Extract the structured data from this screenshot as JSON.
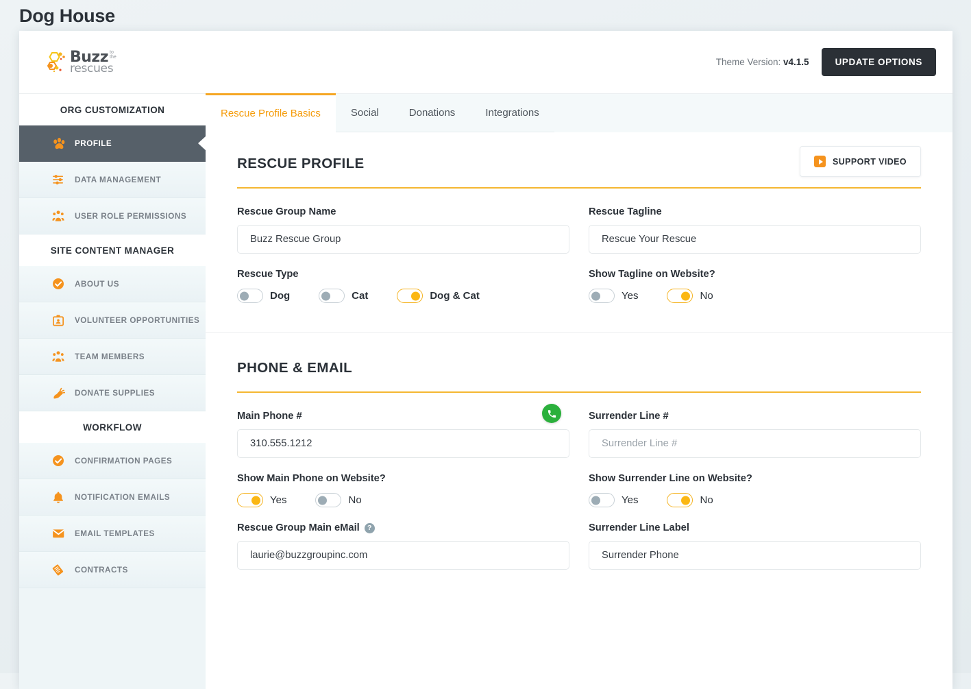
{
  "page": {
    "title": "Dog House"
  },
  "topbar": {
    "logo": {
      "name": "buzz-to-the-rescues-logo",
      "word1": "Buzz",
      "small1": "to",
      "small2": "the",
      "word2": "rescues"
    },
    "theme_version_label": "Theme Version:",
    "theme_version_value": "v4.1.5",
    "update_button": "UPDATE OPTIONS"
  },
  "sidebar": {
    "groups": [
      {
        "heading": "ORG CUSTOMIZATION",
        "items": [
          {
            "label": "PROFILE",
            "icon": "paw-icon",
            "active": true
          },
          {
            "label": "DATA MANAGEMENT",
            "icon": "sliders-icon",
            "active": false
          },
          {
            "label": "USER ROLE PERMISSIONS",
            "icon": "users-icon",
            "active": false
          }
        ]
      },
      {
        "heading": "SITE CONTENT MANAGER",
        "items": [
          {
            "label": "ABOUT US",
            "icon": "check-circle-icon",
            "active": false
          },
          {
            "label": "VOLUNTEER OPPORTUNITIES",
            "icon": "id-badge-icon",
            "active": false
          },
          {
            "label": "TEAM MEMBERS",
            "icon": "users-icon",
            "active": false
          },
          {
            "label": "DONATE SUPPLIES",
            "icon": "carrot-icon",
            "active": false
          }
        ]
      },
      {
        "heading": "WORKFLOW",
        "items": [
          {
            "label": "CONFIRMATION PAGES",
            "icon": "check-circle-icon",
            "active": false
          },
          {
            "label": "NOTIFICATION EMAILS",
            "icon": "bell-icon",
            "active": false
          },
          {
            "label": "EMAIL TEMPLATES",
            "icon": "envelope-icon",
            "active": false
          },
          {
            "label": "CONTRACTS",
            "icon": "contract-tag-icon",
            "active": false
          }
        ]
      }
    ]
  },
  "tabs": [
    {
      "label": "Rescue Profile Basics",
      "active": true
    },
    {
      "label": "Social",
      "active": false
    },
    {
      "label": "Donations",
      "active": false
    },
    {
      "label": "Integrations",
      "active": false
    }
  ],
  "rescue_profile": {
    "title": "RESCUE PROFILE",
    "support_video_button": "SUPPORT VIDEO",
    "group_name": {
      "label": "Rescue Group Name",
      "value": "Buzz Rescue Group"
    },
    "tagline": {
      "label": "Rescue Tagline",
      "value": "Rescue Your Rescue"
    },
    "rescue_type": {
      "label": "Rescue Type",
      "options": [
        {
          "label": "Dog",
          "on": false
        },
        {
          "label": "Cat",
          "on": false
        },
        {
          "label": "Dog & Cat",
          "on": true
        }
      ]
    },
    "show_tagline": {
      "label": "Show Tagline on Website?",
      "options": [
        {
          "label": "Yes",
          "on": false
        },
        {
          "label": "No",
          "on": true
        }
      ]
    }
  },
  "phone_email": {
    "title": "PHONE & EMAIL",
    "main_phone": {
      "label": "Main Phone #",
      "value": "310.555.1212",
      "verified": true,
      "verified_icon": "phone-check-icon"
    },
    "surrender_line": {
      "label": "Surrender Line #",
      "placeholder": "Surrender Line #",
      "value": ""
    },
    "show_main_phone": {
      "label": "Show Main Phone on Website?",
      "options": [
        {
          "label": "Yes",
          "on": true
        },
        {
          "label": "No",
          "on": false
        }
      ]
    },
    "show_surrender_line": {
      "label": "Show Surrender Line on Website?",
      "options": [
        {
          "label": "Yes",
          "on": false
        },
        {
          "label": "No",
          "on": true
        }
      ]
    },
    "main_email": {
      "label": "Rescue Group Main eMail",
      "value": "laurie@buzzgroupinc.com",
      "help": "?"
    },
    "surrender_label": {
      "label": "Surrender Line Label",
      "value": "Surrender Phone"
    }
  },
  "colors": {
    "accent": "#f5a623",
    "active_nav": "#566069",
    "dark": "#2b3036",
    "success": "#2bb03c"
  }
}
